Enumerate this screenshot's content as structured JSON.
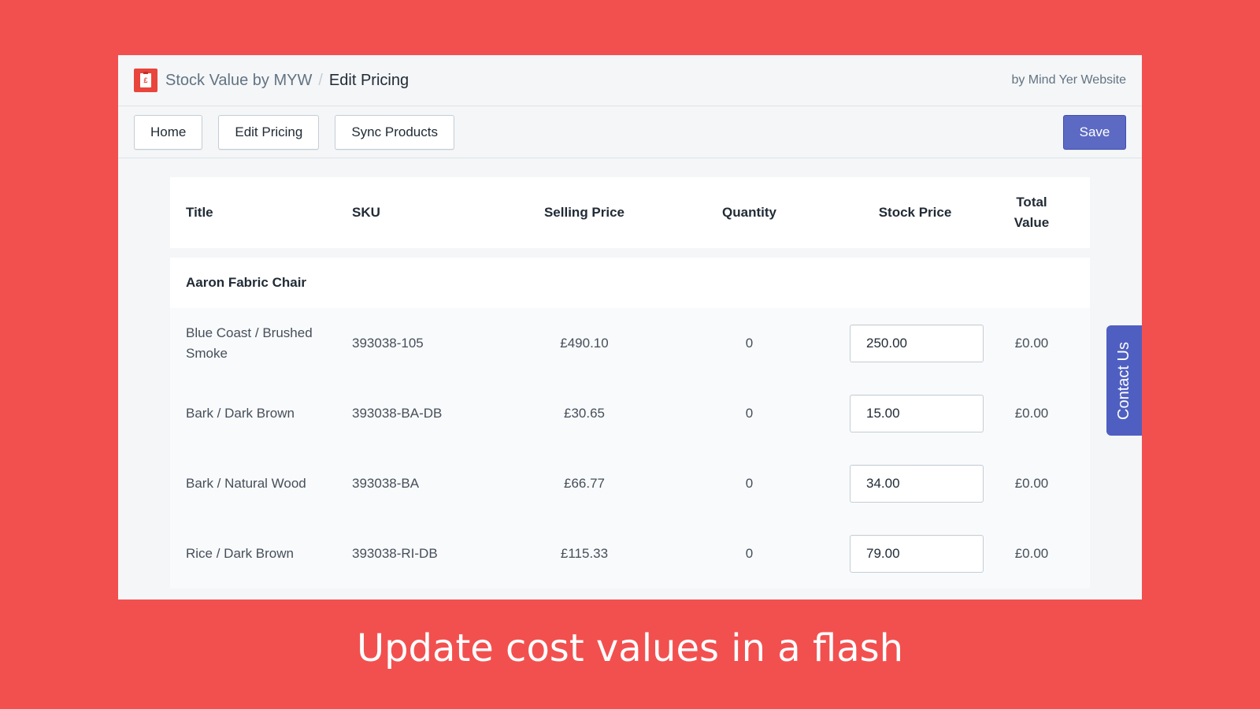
{
  "header": {
    "app_name": "Stock Value by MYW",
    "separator": "/",
    "page_name": "Edit Pricing",
    "byline": "by Mind Yer Website"
  },
  "toolbar": {
    "home_label": "Home",
    "edit_pricing_label": "Edit Pricing",
    "sync_label": "Sync Products",
    "save_label": "Save"
  },
  "table": {
    "columns": [
      "Title",
      "SKU",
      "Selling Price",
      "Quantity",
      "Stock Price",
      "Total Value"
    ],
    "group_title": "Aaron Fabric Chair",
    "rows": [
      {
        "title": "Blue Coast / Brushed Smoke",
        "sku": "393038-105",
        "selling_price": "£490.10",
        "quantity": "0",
        "stock_price": "250.00",
        "total": "£0.00"
      },
      {
        "title": "Bark / Dark Brown",
        "sku": "393038-BA-DB",
        "selling_price": "£30.65",
        "quantity": "0",
        "stock_price": "15.00",
        "total": "£0.00"
      },
      {
        "title": "Bark / Natural Wood",
        "sku": "393038-BA",
        "selling_price": "£66.77",
        "quantity": "0",
        "stock_price": "34.00",
        "total": "£0.00"
      },
      {
        "title": "Rice / Dark Brown",
        "sku": "393038-RI-DB",
        "selling_price": "£115.33",
        "quantity": "0",
        "stock_price": "79.00",
        "total": "£0.00"
      }
    ]
  },
  "contact_tab": "Contact Us",
  "caption": "Update cost values in a flash",
  "colors": {
    "background": "#f2504f",
    "primary_button": "#5c6ac4",
    "contact_tab": "#4f5fc1"
  }
}
